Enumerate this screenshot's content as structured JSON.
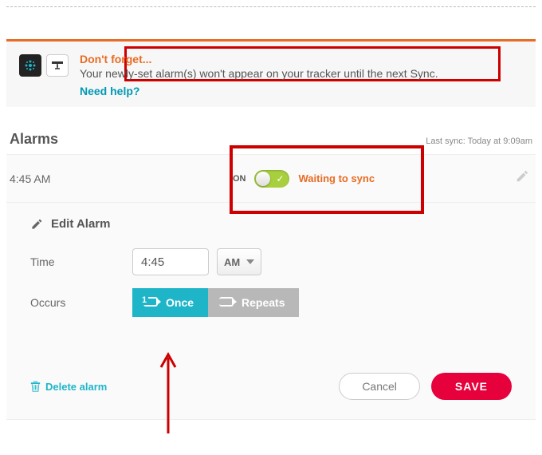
{
  "notice": {
    "title": "Don't forget...",
    "body": "Your newly-set alarm(s) won't appear on your tracker until the next Sync.",
    "help_link": "Need help?"
  },
  "alarms": {
    "header": "Alarms",
    "last_sync": "Last sync: Today at 9:09am",
    "row": {
      "time": "4:45 AM",
      "toggle_label": "ON",
      "toggle_on": true,
      "status": "Waiting to sync"
    }
  },
  "edit": {
    "header": "Edit Alarm",
    "labels": {
      "time": "Time",
      "occurs": "Occurs"
    },
    "time_value": "4:45",
    "ampm": "AM",
    "occurs": {
      "once": "Once",
      "repeats": "Repeats",
      "selected": "once"
    },
    "delete_label": "Delete alarm",
    "cancel": "Cancel",
    "save": "SAVE"
  },
  "colors": {
    "accent": "#1fb5c9",
    "warn": "#e86c23",
    "save": "#e6003c",
    "highlight_box": "#cc0000"
  }
}
